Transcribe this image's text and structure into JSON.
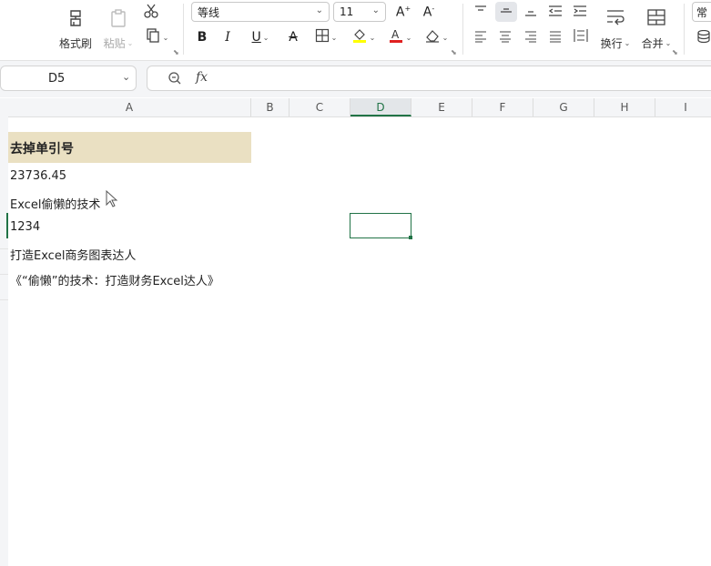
{
  "ribbon": {
    "format_painter_label": "格式刷",
    "paste_label": "粘贴",
    "font_name": "等线",
    "font_size": "11",
    "wrap_label": "换行",
    "merge_label": "合并",
    "number_format_partial": "常",
    "accent_colors": {
      "highlight": "#ffff00",
      "font_color": "#e02020"
    }
  },
  "formula_bar": {
    "name_box_value": "D5",
    "fx_label": "fx",
    "formula_value": ""
  },
  "grid": {
    "columns": [
      "A",
      "B",
      "C",
      "D",
      "E",
      "F",
      "G",
      "H",
      "I"
    ],
    "selected_column": "D",
    "selected_cell": "D5",
    "header_fill": "#eae0c2",
    "selection_color": "#217346",
    "cells": {
      "A2": "去掉单引号",
      "A3": "23736.45",
      "A4": "Excel偷懒的技术",
      "A5": "1234",
      "A6": "打造Excel商务图表达人",
      "A7": "《“偷懒”的技术：打造财务Excel达人》"
    }
  }
}
